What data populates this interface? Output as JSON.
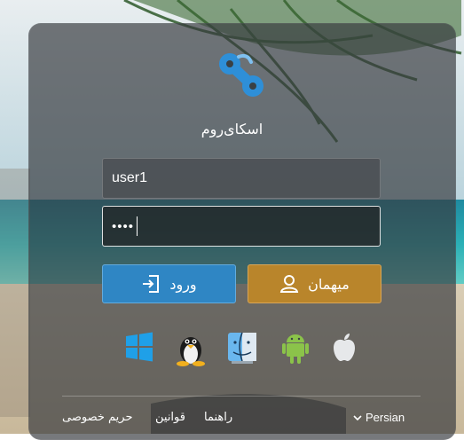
{
  "app": {
    "name": "اسکای‌روم"
  },
  "login": {
    "username_value": "user1",
    "password_dots": "••••",
    "login_label": "ورود",
    "guest_label": "میهمان"
  },
  "platforms": [
    "apple-icon",
    "android-icon",
    "macos-finder-icon",
    "linux-icon",
    "windows-icon"
  ],
  "footer": {
    "language": "Persian",
    "links": {
      "privacy": "حریم خصوصی",
      "rules": "قوانین",
      "help": "راهنما"
    }
  },
  "colors": {
    "login_button": "#2f86c4",
    "guest_button": "#b9852b",
    "logo": "#2e8fd8"
  }
}
